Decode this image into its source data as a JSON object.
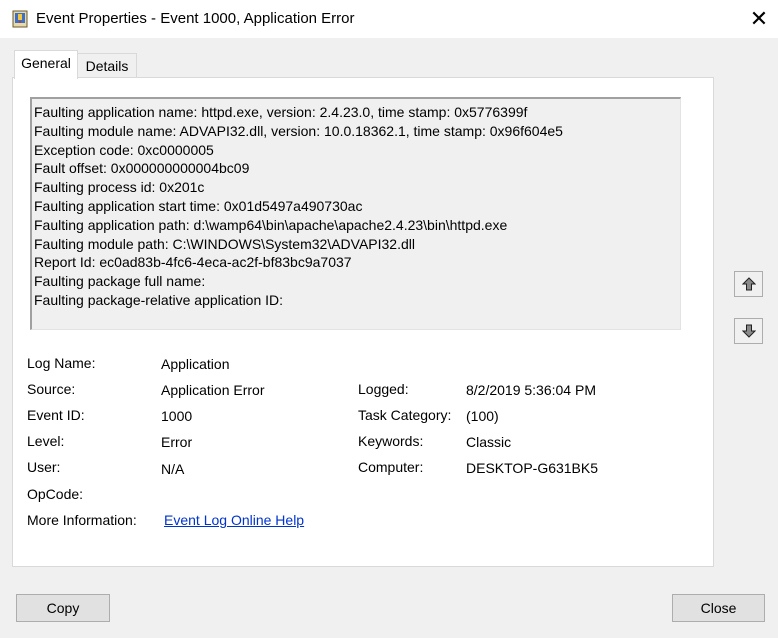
{
  "window": {
    "title": "Event Properties - Event 1000, Application Error",
    "close_glyph": "✕"
  },
  "tabs": [
    {
      "label": "General",
      "selected": true
    },
    {
      "label": "Details",
      "selected": false
    }
  ],
  "description": [
    "Faulting application name: httpd.exe, version: 2.4.23.0, time stamp: 0x5776399f",
    "Faulting module name: ADVAPI32.dll, version: 10.0.18362.1, time stamp: 0x96f604e5",
    "Exception code: 0xc0000005",
    "Fault offset: 0x000000000004bc09",
    "Faulting process id: 0x201c",
    "Faulting application start time: 0x01d5497a490730ac",
    "Faulting application path: d:\\wamp64\\bin\\apache\\apache2.4.23\\bin\\httpd.exe",
    "Faulting module path: C:\\WINDOWS\\System32\\ADVAPI32.dll",
    "Report Id: ec0ad83b-4fc6-4eca-ac2f-bf83bc9a7037",
    "Faulting package full name: ",
    "Faulting package-relative application ID: "
  ],
  "fields": {
    "log_name": {
      "label": "Log Name:",
      "value": "Application"
    },
    "source": {
      "label": "Source:",
      "value": "Application Error"
    },
    "event_id": {
      "label": "Event ID:",
      "value": "1000"
    },
    "level": {
      "label": "Level:",
      "value": "Error"
    },
    "user": {
      "label": "User:",
      "value": "N/A"
    },
    "opcode": {
      "label": "OpCode:",
      "value": ""
    },
    "more_info": {
      "label": "More Information:",
      "value": "Event Log Online Help"
    },
    "logged": {
      "label": "Logged:",
      "value": "8/2/2019 5:36:04 PM"
    },
    "task_category": {
      "label": "Task Category:",
      "value": "(100)"
    },
    "keywords": {
      "label": "Keywords:",
      "value": "Classic"
    },
    "computer": {
      "label": "Computer:",
      "value": "DESKTOP-G631BK5"
    }
  },
  "buttons": {
    "copy": "Copy",
    "close": "Close"
  },
  "icons": {
    "app": "event-viewer-icon",
    "up": "arrow-up-icon",
    "down": "arrow-down-icon"
  },
  "colors": {
    "link": "#0033cc",
    "panel_bg": "#ffffff",
    "dialog_bg": "#f0f0f0"
  }
}
